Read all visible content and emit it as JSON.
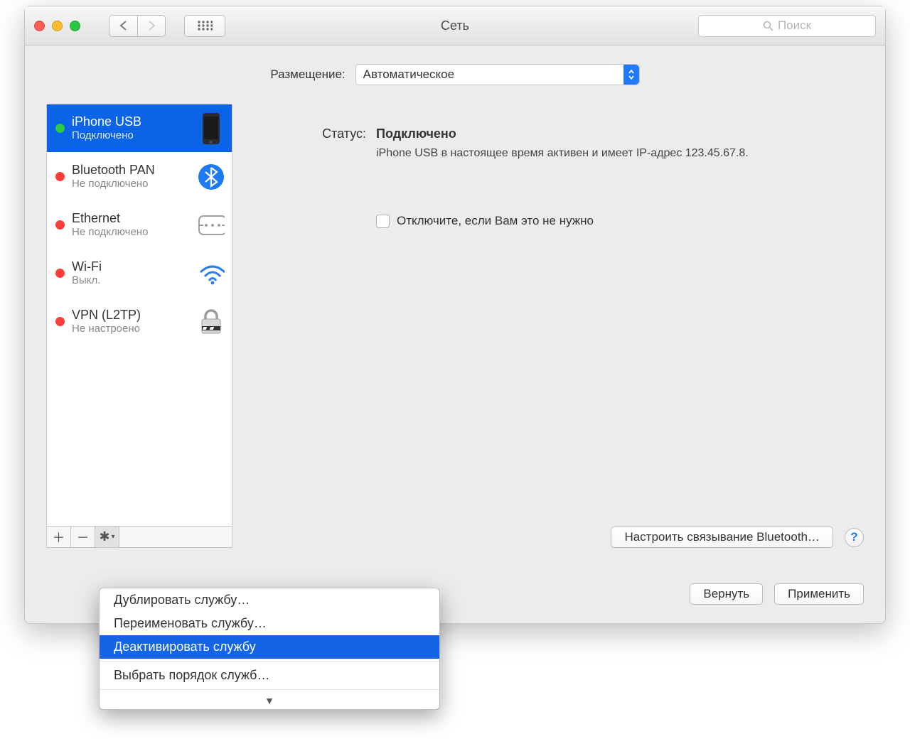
{
  "title": "Сеть",
  "search_placeholder": "Поиск",
  "location_label": "Размещение:",
  "location_value": "Автоматическое",
  "services": [
    {
      "name": "iPhone USB",
      "status": "Подключено",
      "dot": "green",
      "selected": true,
      "icon": "phone"
    },
    {
      "name": "Bluetooth PAN",
      "status": "Не подключено",
      "dot": "red",
      "selected": false,
      "icon": "bluetooth"
    },
    {
      "name": "Ethernet",
      "status": "Не подключено",
      "dot": "red",
      "selected": false,
      "icon": "ethernet"
    },
    {
      "name": "Wi-Fi",
      "status": "Выкл.",
      "dot": "red",
      "selected": false,
      "icon": "wifi"
    },
    {
      "name": "VPN (L2TP)",
      "status": "Не настроено",
      "dot": "red",
      "selected": false,
      "icon": "lock"
    }
  ],
  "detail": {
    "status_label": "Статус:",
    "status_value": "Подключено",
    "status_desc": "iPhone USB  в настоящее время активен и имеет IP-адрес 123.45.67.8.",
    "checkbox_label": "Отключите, если Вам это не нужно",
    "configure_btn": "Настроить связывание Bluetooth…",
    "help": "?"
  },
  "footer": {
    "revert": "Вернуть",
    "apply": "Применить"
  },
  "popup": {
    "items": [
      "Дублировать службу…",
      "Переименовать службу…",
      "Деактивировать службу"
    ],
    "highlighted_index": 2,
    "after": "Выбрать порядок служб…"
  }
}
